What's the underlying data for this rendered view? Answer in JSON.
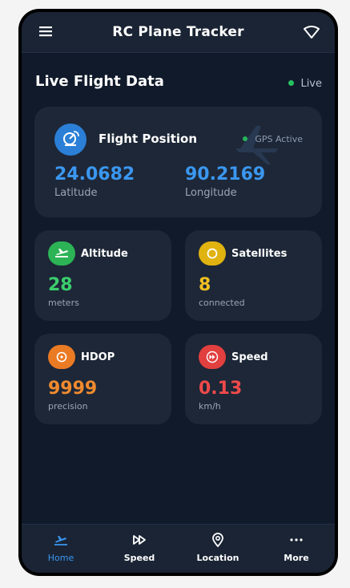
{
  "app": {
    "title": "RC Plane Tracker"
  },
  "section": {
    "title": "Live Flight Data",
    "live_label": "Live"
  },
  "position": {
    "title": "Flight Position",
    "gps_status": "GPS Active",
    "latitude_value": "24.0682",
    "latitude_label": "Latitude",
    "longitude_value": "90.2169",
    "longitude_label": "Longitude"
  },
  "stats": {
    "altitude": {
      "title": "Altitude",
      "value": "28",
      "unit": "meters",
      "color": "#3bcf6d",
      "icon": "takeoff-icon"
    },
    "satellites": {
      "title": "Satellites",
      "value": "8",
      "unit": "connected",
      "color": "#f0c020",
      "icon": "circle-icon"
    },
    "hdop": {
      "title": "HDOP",
      "value": "9999",
      "unit": "precision",
      "color": "#f08a2e",
      "icon": "target-icon"
    },
    "speed": {
      "title": "Speed",
      "value": "0.13",
      "unit": "km/h",
      "color": "#ef4a4a",
      "icon": "fast-forward-icon"
    }
  },
  "nav": {
    "items": [
      {
        "label": "Home",
        "icon": "takeoff-icon",
        "active": true
      },
      {
        "label": "Speed",
        "icon": "fast-forward-icon",
        "active": false
      },
      {
        "label": "Location",
        "icon": "location-pin-icon",
        "active": false
      },
      {
        "label": "More",
        "icon": "more-dots-icon",
        "active": false
      }
    ]
  },
  "colors": {
    "accent": "#3b97f0",
    "background": "#101a2a",
    "card": "#1d2737"
  }
}
